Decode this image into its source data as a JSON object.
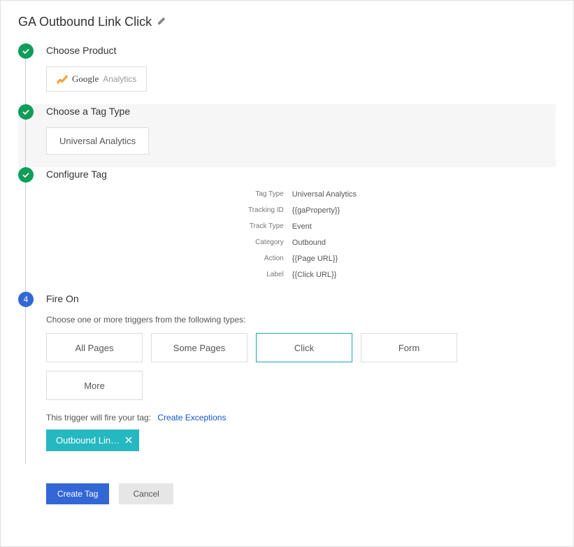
{
  "title": "GA Outbound Link Click",
  "steps": {
    "product": {
      "heading": "Choose Product",
      "brand_strong": "Google",
      "brand_light": "Analytics"
    },
    "tagtype": {
      "heading": "Choose a Tag Type",
      "value": "Universal Analytics"
    },
    "configure": {
      "heading": "Configure Tag",
      "rows": {
        "tag_type_key": "Tag Type",
        "tag_type_val": "Universal Analytics",
        "tracking_id_key": "Tracking ID",
        "tracking_id_val": "{{gaProperty}}",
        "track_type_key": "Track Type",
        "track_type_val": "Event",
        "category_key": "Category",
        "category_val": "Outbound",
        "action_key": "Action",
        "action_val": "{{Page URL}}",
        "label_key": "Label",
        "label_val": "{{Click URL}}"
      }
    },
    "fire": {
      "number": "4",
      "heading": "Fire On",
      "hint": "Choose one or more triggers from the following types:",
      "triggers": {
        "all_pages": "All Pages",
        "some_pages": "Some Pages",
        "click": "Click",
        "form": "Form",
        "more": "More"
      },
      "note_prefix": "This trigger will fire your tag:",
      "note_link": "Create Exceptions",
      "chip_label": "Outbound Lin…"
    }
  },
  "buttons": {
    "create": "Create Tag",
    "cancel": "Cancel"
  }
}
